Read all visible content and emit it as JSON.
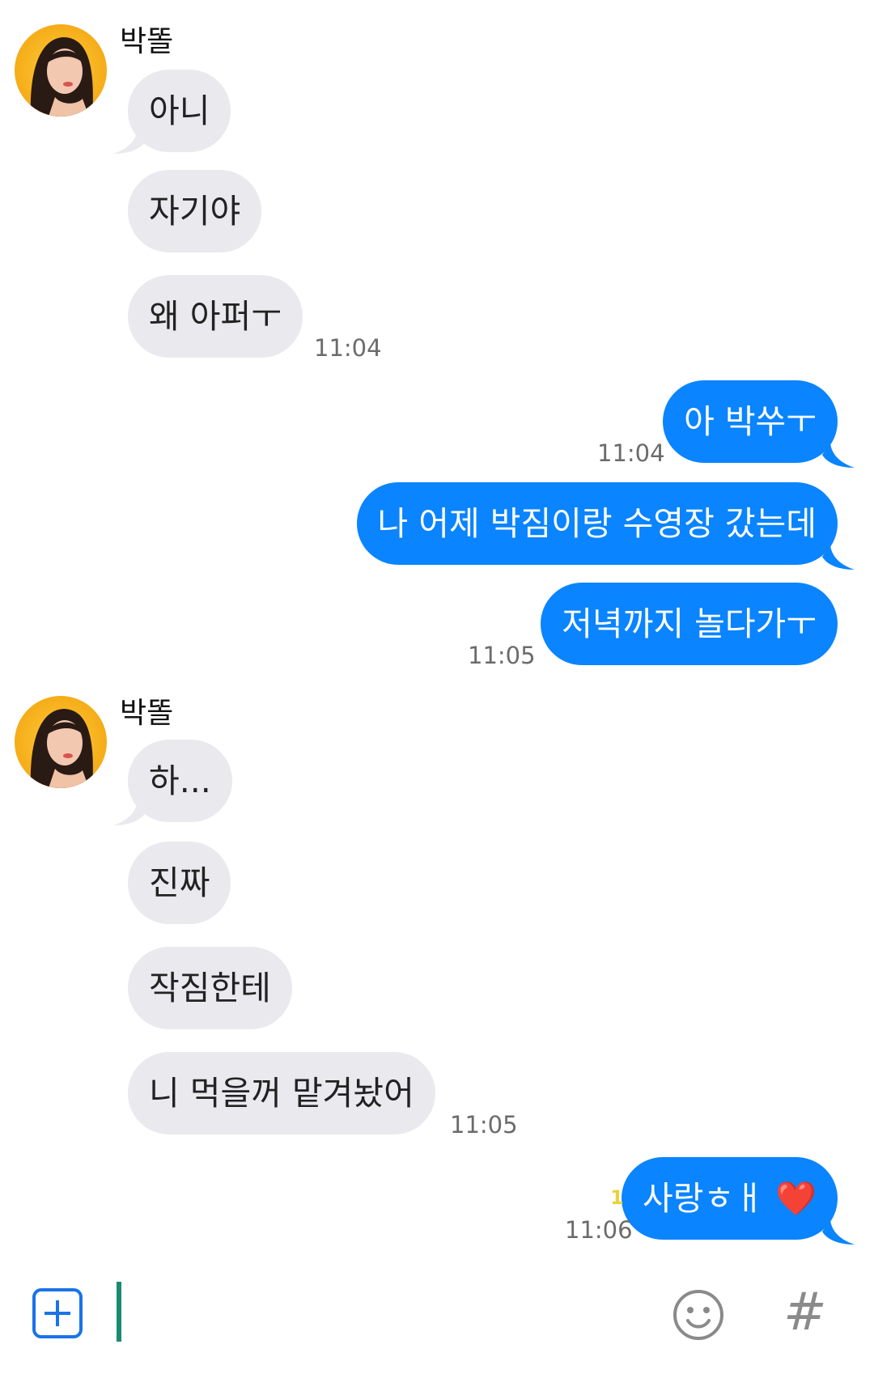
{
  "chat": {
    "groups": [
      {
        "sender": "박똘",
        "messages": [
          "아니",
          "자기야",
          "왜 아퍼ㅜ"
        ],
        "time": "11:04"
      },
      {
        "messages": [
          "아 박쑤ㅜ"
        ],
        "time": "11:04"
      },
      {
        "messages": [
          "나 어제 박짐이랑 수영장 갔는데",
          "저녁까지 놀다가ㅜ"
        ],
        "time": "11:05"
      },
      {
        "sender": "박똘",
        "messages": [
          "하...",
          "진짜",
          "작짐한테",
          "니 먹을꺼 맡겨놨어"
        ],
        "time": "11:05"
      },
      {
        "messages": [
          "사랑ㅎㅐ"
        ],
        "emoji": "❤️",
        "unread_count": "1",
        "time": "11:06"
      }
    ]
  },
  "composer": {
    "add_icon": "plus-square-icon",
    "emoji_icon": "smiley-icon",
    "hash_icon": "hashtag-icon",
    "hash_symbol": "#"
  },
  "colors": {
    "outgoing_bubble": "#0a84ff",
    "incoming_bubble": "#e9e9ee",
    "cursor": "#1a8a73",
    "icon_blue": "#1a73e8"
  }
}
